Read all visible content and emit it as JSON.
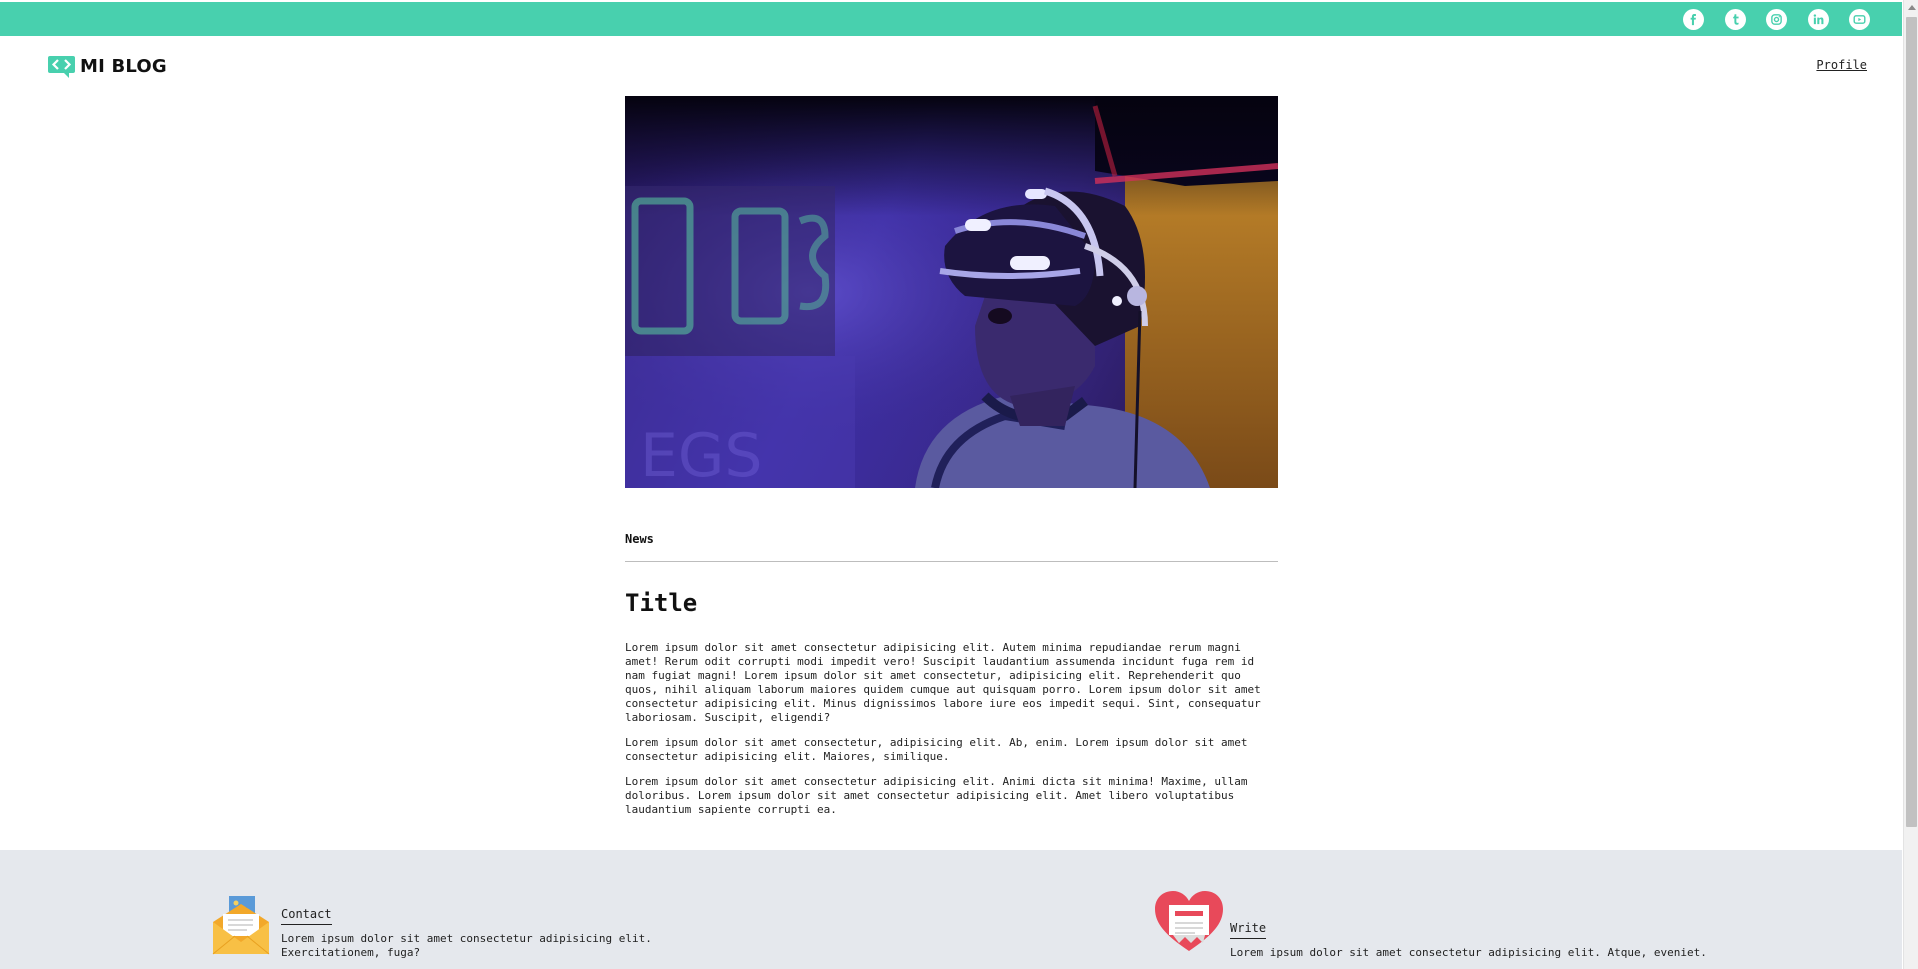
{
  "header": {
    "brand": "MI BLOG",
    "profile_label": "Profile",
    "accent_color": "#48d0ae"
  },
  "social_icons": [
    "facebook-icon",
    "tumblr-icon",
    "instagram-icon",
    "linkedin-icon",
    "youtube-icon"
  ],
  "article": {
    "category": "News",
    "title": "Title",
    "paragraphs": [
      "Lorem ipsum dolor sit amet consectetur adipisicing elit. Autem minima repudiandae rerum magni amet! Rerum odit corrupti modi impedit vero! Suscipit laudantium assumenda incidunt fuga rem id nam fugiat magni! Lorem ipsum dolor sit amet consectetur, adipisicing elit. Reprehenderit quo quos, nihil aliquam laborum maiores quidem cumque aut quisquam porro. Lorem ipsum dolor sit amet consectetur adipisicing elit. Minus dignissimos labore iure eos impedit sequi. Sint, consequatur laboriosam. Suscipit, eligendi?",
      "Lorem ipsum dolor sit amet consectetur, adipisicing elit. Ab, enim. Lorem ipsum dolor sit amet consectetur adipisicing elit. Maiores, similique.",
      "Lorem ipsum dolor sit amet consectetur adipisicing elit. Animi dicta sit minima! Maxime, ullam doloribus. Lorem ipsum dolor sit amet consectetur adipisicing elit. Amet libero voluptatibus laudantium sapiente corrupti ea."
    ]
  },
  "footer": {
    "contact": {
      "title": "Contact",
      "text": "Lorem ipsum dolor sit amet consectetur adipisicing elit. Exercitationem, fuga?",
      "icon": "envelope-icon"
    },
    "write": {
      "title": "Write",
      "text": "Lorem ipsum dolor sit amet consectetur adipisicing elit. Atque, eveniet.",
      "icon": "heart-document-icon"
    },
    "background": "#e5e8ed"
  }
}
